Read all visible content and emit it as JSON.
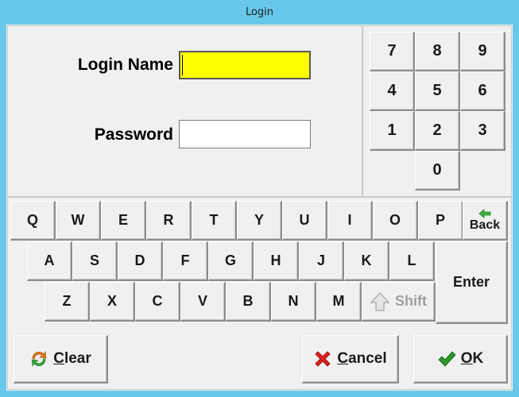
{
  "window": {
    "title": "Login"
  },
  "form": {
    "login_label": "Login Name",
    "login_value": "",
    "password_label": "Password",
    "password_value": ""
  },
  "numpad": [
    "7",
    "8",
    "9",
    "4",
    "5",
    "6",
    "1",
    "2",
    "3",
    "0"
  ],
  "keyboard": {
    "row1": [
      "Q",
      "W",
      "E",
      "R",
      "T",
      "Y",
      "U",
      "I",
      "O",
      "P"
    ],
    "row2": [
      "A",
      "S",
      "D",
      "F",
      "G",
      "H",
      "J",
      "K",
      "L"
    ],
    "row3": [
      "Z",
      "X",
      "C",
      "V",
      "B",
      "N",
      "M"
    ],
    "back_label": "Back",
    "shift_label": "Shift",
    "enter_label": "Enter"
  },
  "actions": {
    "clear_first": "C",
    "clear_rest": "lear",
    "cancel_first": "C",
    "cancel_rest": "ancel",
    "ok_first": "O",
    "ok_rest": "K"
  },
  "colors": {
    "titlebar": "#68c8ec",
    "active_field": "#ffff00",
    "back_arrow": "#3cb43c",
    "cancel_x": "#e02020",
    "ok_check": "#2a9a2a"
  },
  "icons": [
    "back-arrow-icon",
    "shift-arrow-icon",
    "clear-refresh-icon",
    "cancel-x-icon",
    "ok-check-icon"
  ]
}
